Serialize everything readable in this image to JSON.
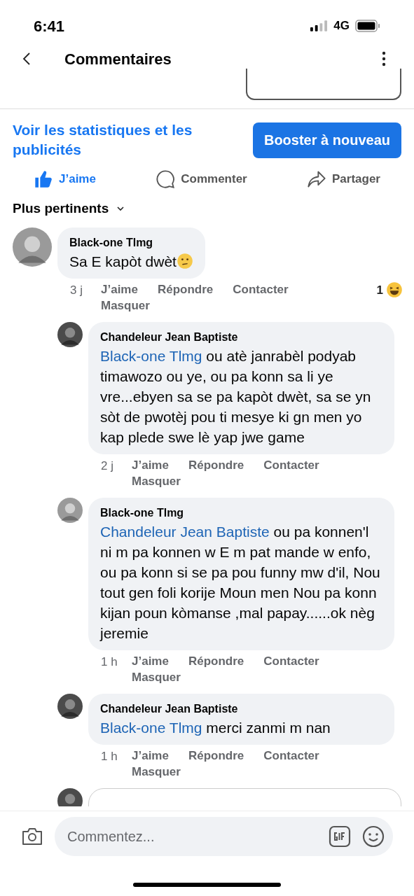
{
  "status_bar": {
    "time": "6:41",
    "network": "4G"
  },
  "header": {
    "title": "Commentaires"
  },
  "post_actions": {
    "stats_link": "Voir les statistiques et les publicités",
    "boost_button": "Booster à nouveau",
    "buttons": [
      {
        "kind": "like",
        "label": "J’aime",
        "selected": true
      },
      {
        "kind": "comment",
        "label": "Commenter",
        "selected": false
      },
      {
        "kind": "share",
        "label": "Partager",
        "selected": false
      }
    ]
  },
  "sort": {
    "label": "Plus pertinents"
  },
  "comments": [
    {
      "kind": "top",
      "author": "Black-one Tlmg",
      "text": "Sa E kapòt dwèt",
      "emoji": true,
      "time": "3 j",
      "actions": [
        "J’aime",
        "Répondre",
        "Contacter",
        "Masquer"
      ],
      "reaction_count": "1"
    },
    {
      "kind": "reply",
      "author": "Chandeleur Jean Baptiste",
      "mention": "Black-one Tlmg",
      "text": "ou atè janrabèl podyab timawozo ou ye, ou pa konn sa li ye vre...ebyen sa se pa kapòt dwèt, sa se yn sòt de pwotèj pou ti mesye ki gn men yo kap plede swe lè yap jwe game",
      "time": "2 j",
      "actions": [
        "J’aime",
        "Répondre",
        "Contacter",
        "Masquer"
      ]
    },
    {
      "kind": "reply",
      "author": "Black-one Tlmg",
      "mention": "Chandeleur Jean Baptiste",
      "text": "ou pa konnen'l ni m pa konnen w E m pat mande w enfo, ou pa konn si se pa pou funny mw d'il, Nou tout gen foli korije Moun men Nou pa konn kijan poun kòmanse ,mal papay......ok nèg jeremie",
      "time": "1 h",
      "actions": [
        "J’aime",
        "Répondre",
        "Contacter",
        "Masquer"
      ]
    },
    {
      "kind": "reply",
      "author": "Chandeleur Jean Baptiste",
      "mention": "Black-one Tlmg",
      "text": "merci zanmi m nan",
      "time": "1 h",
      "actions": [
        "J’aime",
        "Répondre",
        "Contacter",
        "Masquer"
      ]
    }
  ],
  "composer": {
    "placeholder": "Commentez..."
  }
}
